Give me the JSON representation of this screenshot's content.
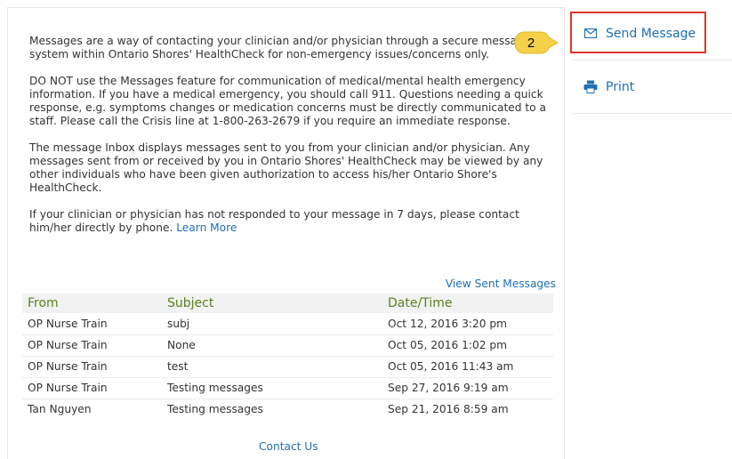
{
  "intro": {
    "p1": "Messages are a way of contacting your clinician and/or physician through a secure message system within Ontario Shores' HealthCheck for non-emergency issues/concerns only.",
    "p2": "DO NOT use the Messages feature for communication of medical/mental health emergency information. If you have a medical emergency, you should call 911. Questions needing a quick response, e.g. symptoms changes or medication concerns must be directly communicated to a staff. Please call the Crisis line at 1-800-263-2679 if you require an immediate response.",
    "p3": "The message Inbox displays messages sent to you from your clinician and/or physician. Any messages sent from or received by you in Ontario Shores' HealthCheck may be viewed by any other individuals who have been given authorization to access his/her Ontario Shore's HealthCheck.",
    "p4": "If your clinician or physician has not responded to your message in 7 days, please contact him/her directly by phone.",
    "learn_more": "Learn More"
  },
  "view_sent_label": "View Sent Messages",
  "table": {
    "headers": {
      "from": "From",
      "subject": "Subject",
      "datetime": "Date/Time"
    },
    "rows": [
      {
        "from": "OP Nurse Train",
        "subject": "subj",
        "datetime": "Oct 12, 2016 3:20 pm"
      },
      {
        "from": "OP Nurse Train",
        "subject": "None",
        "datetime": "Oct 05, 2016 1:02 pm"
      },
      {
        "from": "OP Nurse Train",
        "subject": "test",
        "datetime": "Oct 05, 2016 11:43 am"
      },
      {
        "from": "OP Nurse Train",
        "subject": "Testing messages",
        "datetime": "Sep 27, 2016 9:19 am"
      },
      {
        "from": "Tan Nguyen",
        "subject": "Testing messages",
        "datetime": "Sep 21, 2016 8:59 am"
      }
    ]
  },
  "contact_label": "Contact Us",
  "sidebar": {
    "send_message": {
      "label": "Send Message",
      "icon": "envelope-icon"
    },
    "print": {
      "label": "Print",
      "icon": "printer-icon"
    }
  },
  "callout": {
    "number": "2"
  },
  "colors": {
    "link": "#1f6fb2",
    "header_text": "#5a7f1e",
    "highlight": "#d9372b",
    "callout": "#f5d14a"
  }
}
